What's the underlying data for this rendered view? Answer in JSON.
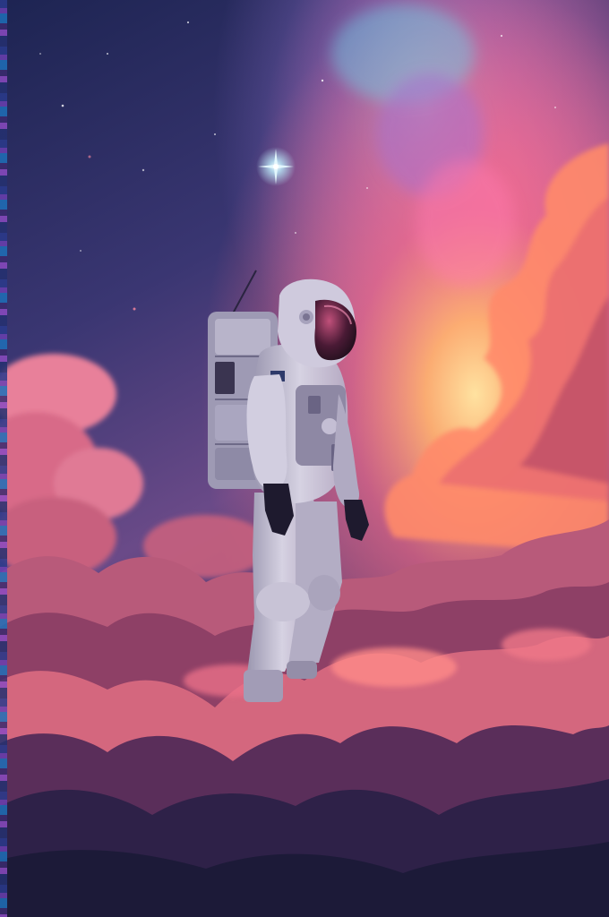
{
  "scene": {
    "subject": "astronaut",
    "palette": {
      "sky_top": "#1d2452",
      "sky_mid": "#4a3a80",
      "nebula_pink": "#e8608f",
      "nebula_cyan": "#5ad0e6",
      "glow_orange": "#ffb36a",
      "cloud_pink": "#d8667f",
      "cloud_shadow": "#3a2250",
      "suit": "#c9c6d6",
      "visor": "#4a1a35"
    }
  }
}
